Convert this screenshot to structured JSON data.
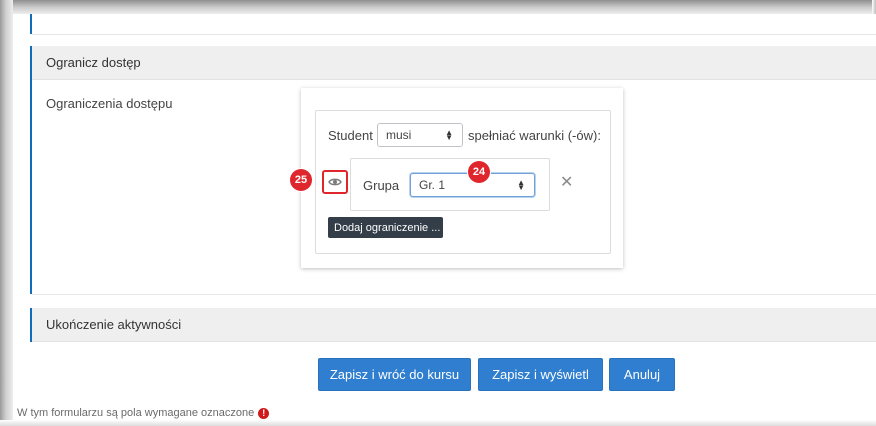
{
  "sections": {
    "restrict_access": {
      "title": "Ogranicz dostęp",
      "field_label": "Ograniczenia dostępu"
    },
    "completion": {
      "title": "Ukończenie aktywności"
    }
  },
  "restriction": {
    "student_label": "Student",
    "must_select": {
      "value": "musi"
    },
    "conditions_suffix": "spełniać warunki (-ów):",
    "condition": {
      "type_label": "Grupa",
      "group_select": {
        "value": "Gr. 1"
      },
      "remove_icon": "close-icon"
    },
    "add_button_label": "Dodaj ograniczenie ..."
  },
  "annotations": {
    "eye_badge": "25",
    "group_badge": "24",
    "badge_color": "#e0262d"
  },
  "actions": {
    "save_return_label": "Zapisz i wróć do kursu",
    "save_display_label": "Zapisz i wyświetl",
    "cancel_label": "Anuluj",
    "primary_color": "#2f7ecf"
  },
  "footer": {
    "required_note": "W tym formularzu są pola wymagane oznaczone",
    "required_icon": "exclamation-circle-icon"
  }
}
